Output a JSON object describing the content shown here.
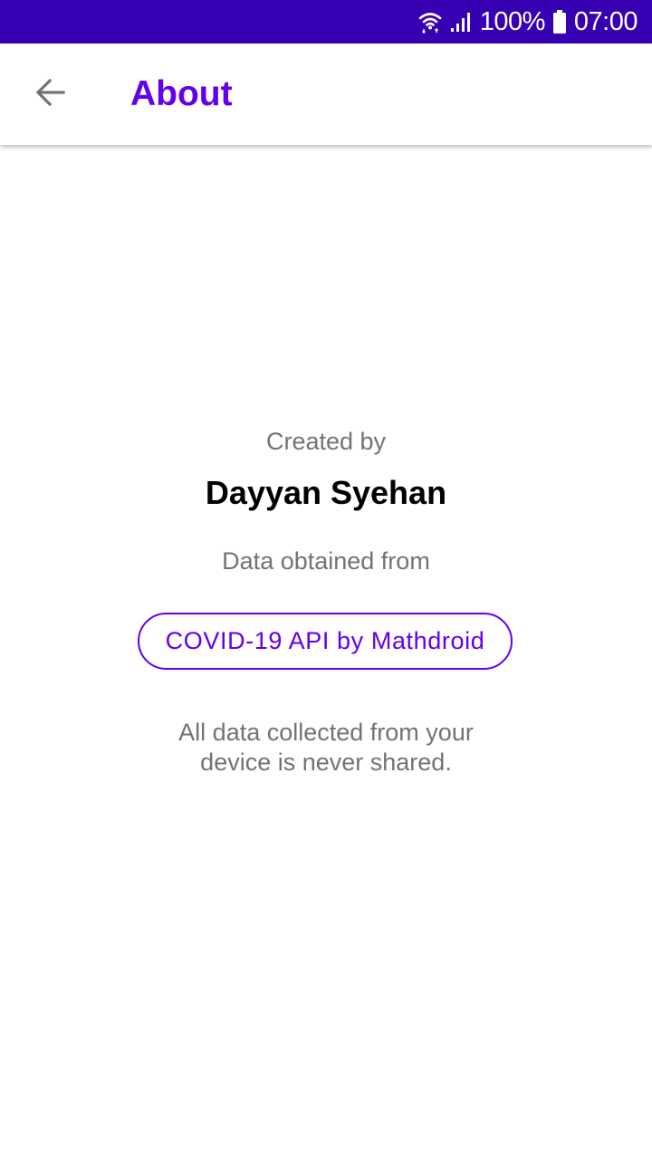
{
  "status_bar": {
    "battery_percent": "100%",
    "time": "07:00",
    "icons": [
      "wifi-icon",
      "signal-icon",
      "battery-icon"
    ]
  },
  "app_bar": {
    "title": "About",
    "back_icon": "arrow-back-icon"
  },
  "content": {
    "created_label": "Created by",
    "author": "Dayyan Syehan",
    "data_label": "Data obtained from",
    "source_button_label": "COVID-19 API by Mathdroid",
    "privacy_line1": "All data collected from your",
    "privacy_line2": "device is never shared."
  },
  "colors": {
    "status_bar": "#3700b3",
    "accent": "#6200ee",
    "secondary_text": "#737373",
    "primary_text": "#000000"
  }
}
